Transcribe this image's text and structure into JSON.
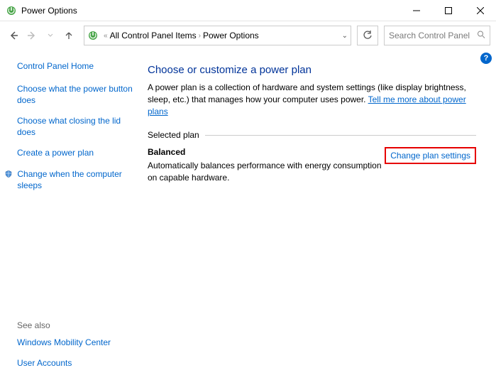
{
  "window": {
    "title": "Power Options"
  },
  "breadcrumb": {
    "item1": "All Control Panel Items",
    "item2": "Power Options"
  },
  "search": {
    "placeholder": "Search Control Panel"
  },
  "sidebar": {
    "home": "Control Panel Home",
    "links": {
      "l0": "Choose what the power button does",
      "l1": "Choose what closing the lid does",
      "l2": "Create a power plan",
      "l3": "Change when the computer sleeps"
    },
    "see_also_label": "See also",
    "see_also": {
      "s0": "Windows Mobility Center",
      "s1": "User Accounts"
    }
  },
  "main": {
    "title": "Choose or customize a power plan",
    "description_pre": "A power plan is a collection of hardware and system settings (like display brightness, sleep, etc.) that manages how your computer uses power. ",
    "description_link": "Tell me more about power plans",
    "section_label": "Selected plan",
    "plan_name": "Balanced",
    "plan_desc": "Automatically balances performance with energy consumption on capable hardware.",
    "change_link": "Change plan settings",
    "help": "?"
  }
}
